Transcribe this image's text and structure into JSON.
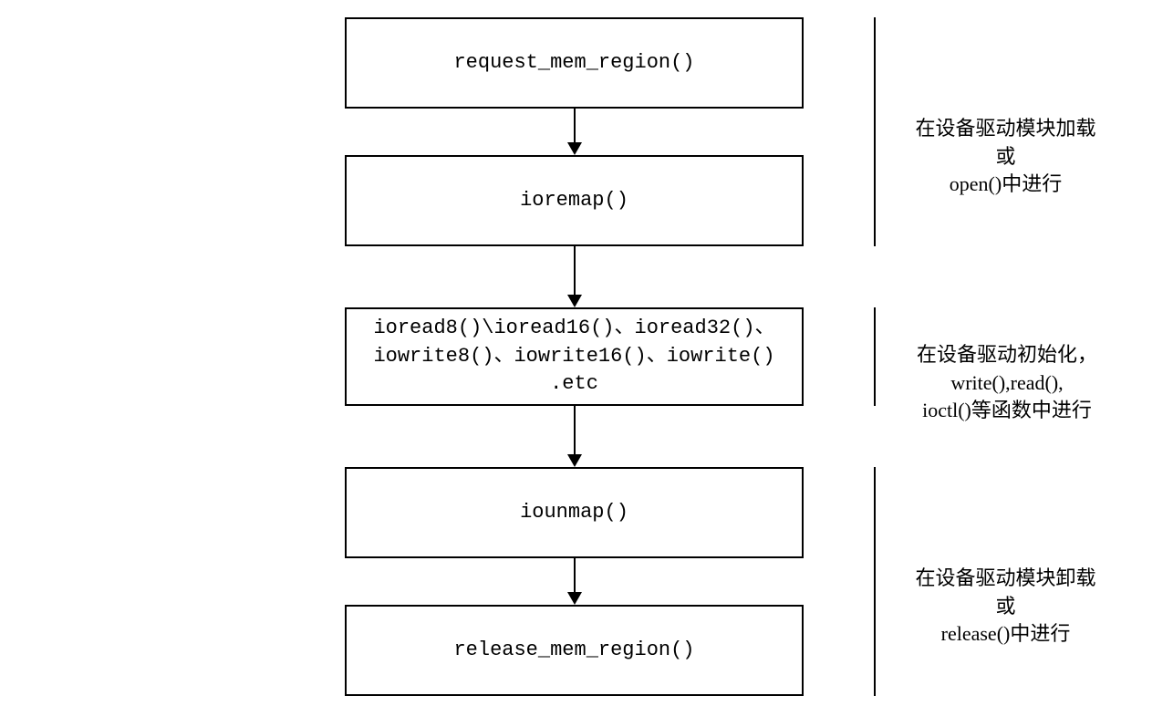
{
  "flow": {
    "box1": "request_mem_region()",
    "box2": "ioremap()",
    "box3": "ioread8()\\ioread16()、ioread32()、\niowrite8()、iowrite16()、iowrite()\n.etc",
    "box4": "iounmap()",
    "box5": "release_mem_region()"
  },
  "annotations": {
    "group1": "在设备驱动模块加载\n或\nopen()中进行",
    "group2": "在设备驱动初始化，\nwrite(),read(),\nioctl()等函数中进行",
    "group3": "在设备驱动模块卸载\n或\nrelease()中进行"
  }
}
